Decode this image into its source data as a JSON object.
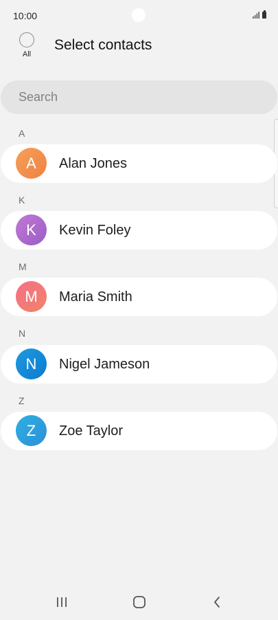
{
  "status_bar": {
    "time": "10:00",
    "icons": [
      "signal-icon",
      "battery-icon"
    ]
  },
  "header": {
    "select_all_label": "All",
    "title": "Select contacts"
  },
  "search": {
    "placeholder": "Search"
  },
  "sections": [
    {
      "letter": "A",
      "contacts": [
        {
          "name": "Alan Jones",
          "initial": "A",
          "avatar_gradient": [
            "#f6a05a",
            "#f08142"
          ]
        }
      ]
    },
    {
      "letter": "K",
      "contacts": [
        {
          "name": "Kevin Foley",
          "initial": "K",
          "avatar_gradient": [
            "#c17ad6",
            "#9a5cc4"
          ]
        }
      ]
    },
    {
      "letter": "M",
      "contacts": [
        {
          "name": "Maria Smith",
          "initial": "M",
          "avatar_gradient": [
            "#f56f86",
            "#f1846a"
          ]
        }
      ]
    },
    {
      "letter": "N",
      "contacts": [
        {
          "name": "Nigel Jameson",
          "initial": "N",
          "avatar_gradient": [
            "#1f9ae0",
            "#0c7bd0"
          ]
        }
      ]
    },
    {
      "letter": "Z",
      "contacts": [
        {
          "name": "Zoe Taylor",
          "initial": "Z",
          "avatar_gradient": [
            "#2fb0e2",
            "#2c8fd8"
          ]
        }
      ]
    }
  ],
  "nav_bar": {
    "buttons": [
      "recents-icon",
      "home-icon",
      "back-icon"
    ]
  },
  "colors": {
    "background": "#f2f2f2",
    "row_background": "#ffffff",
    "search_background": "#e4e4e4"
  }
}
